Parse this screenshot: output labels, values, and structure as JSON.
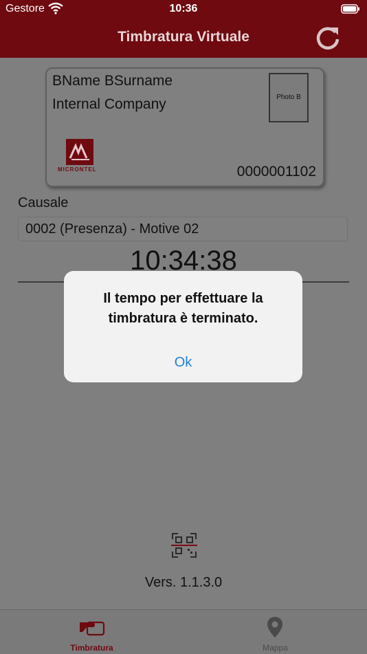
{
  "status_bar": {
    "carrier": "Gestore",
    "time": "10:36"
  },
  "nav": {
    "title": "Timbratura Virtuale"
  },
  "card": {
    "name": "BName BSurname",
    "company": "Internal Company",
    "photo_label": "Photo B",
    "logo_text": "MICRONTEL",
    "code": "0000001102"
  },
  "causale": {
    "label": "Causale",
    "value": "0002 (Presenza) - Motive 02"
  },
  "clock": "10:34:38",
  "version": "Vers. 1.1.3.0",
  "tabs": [
    {
      "label": "Timbratura",
      "icon": "card-hand-icon"
    },
    {
      "label": "Mappa",
      "icon": "map-pin-icon"
    }
  ],
  "alert": {
    "message": "Il tempo per effettuare la timbratura è terminato.",
    "ok": "Ok"
  },
  "colors": {
    "brand": "#6e0a10",
    "accent": "#1e7fd6"
  }
}
